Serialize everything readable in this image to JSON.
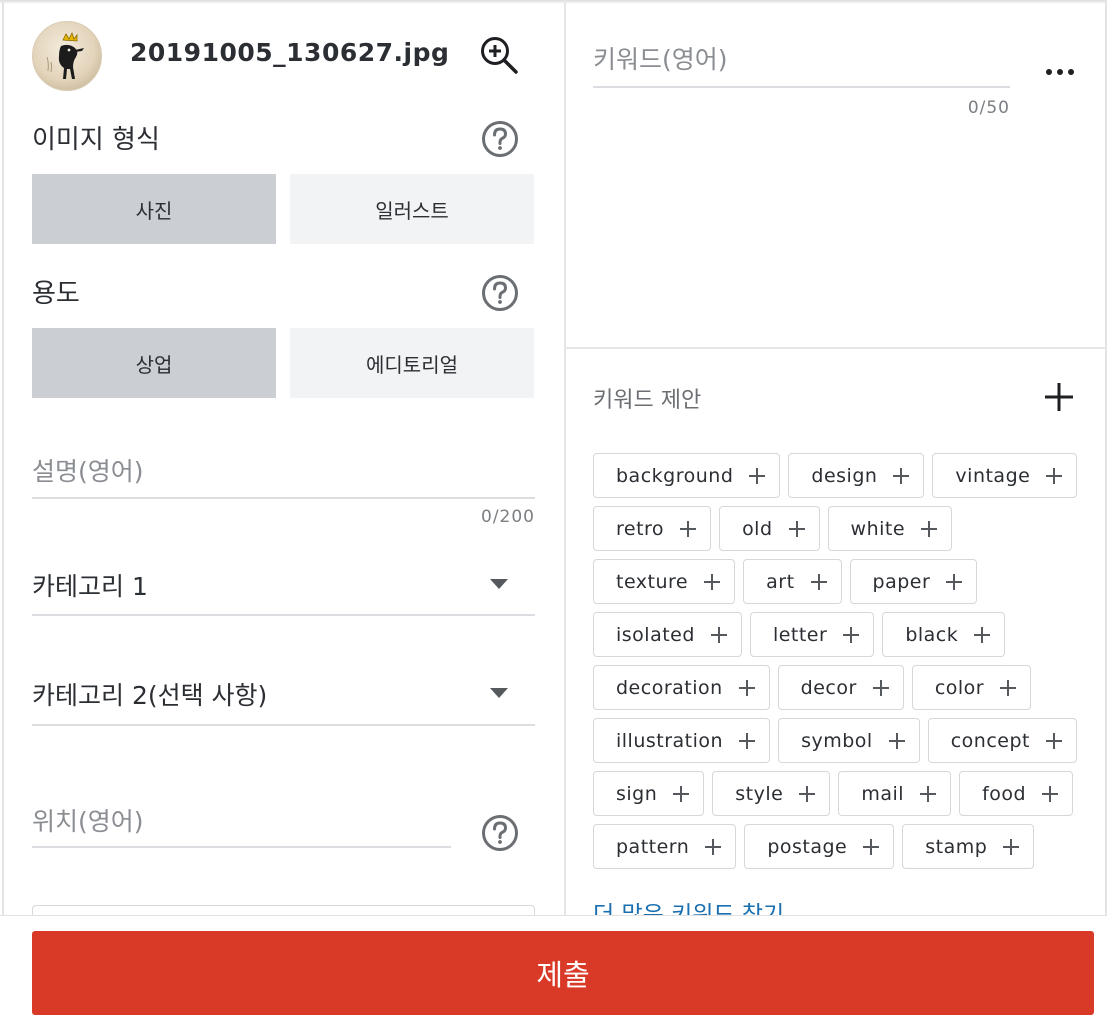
{
  "file": {
    "name": "20191005_130627.jpg",
    "thumbnail_icon": "photo-thumbnail",
    "zoom_icon": "zoom-in-icon"
  },
  "image_type": {
    "label": "이미지 형식",
    "options": [
      "사진",
      "일러스트"
    ],
    "selected": "사진"
  },
  "usage": {
    "label": "용도",
    "options": [
      "상업",
      "에디토리얼"
    ],
    "selected": "상업"
  },
  "description": {
    "placeholder": "설명(영어)",
    "counter": "0/200"
  },
  "category1": {
    "label": "카테고리 1"
  },
  "category2": {
    "label": "카테고리 2(선택 사항)"
  },
  "location": {
    "placeholder": "위치(영어)"
  },
  "keywords": {
    "placeholder": "키워드(영어)",
    "counter": "0/50"
  },
  "suggestions": {
    "title": "키워드 제안",
    "rows": [
      [
        "background",
        "design",
        "vintage"
      ],
      [
        "retro",
        "old",
        "white"
      ],
      [
        "texture",
        "art",
        "paper"
      ],
      [
        "isolated",
        "letter",
        "black"
      ],
      [
        "decoration",
        "decor",
        "color"
      ],
      [
        "illustration",
        "symbol",
        "concept"
      ],
      [
        "sign",
        "style",
        "mail",
        "food"
      ],
      [
        "pattern",
        "postage",
        "stamp"
      ]
    ],
    "more_link": "더 많은 키워드 찾기"
  },
  "submit": {
    "label": "제출"
  },
  "colors": {
    "submit": "#d93a27",
    "selected_segment": "#cbced2",
    "unselected_segment": "#f2f3f5",
    "link": "#1a6fb0"
  }
}
